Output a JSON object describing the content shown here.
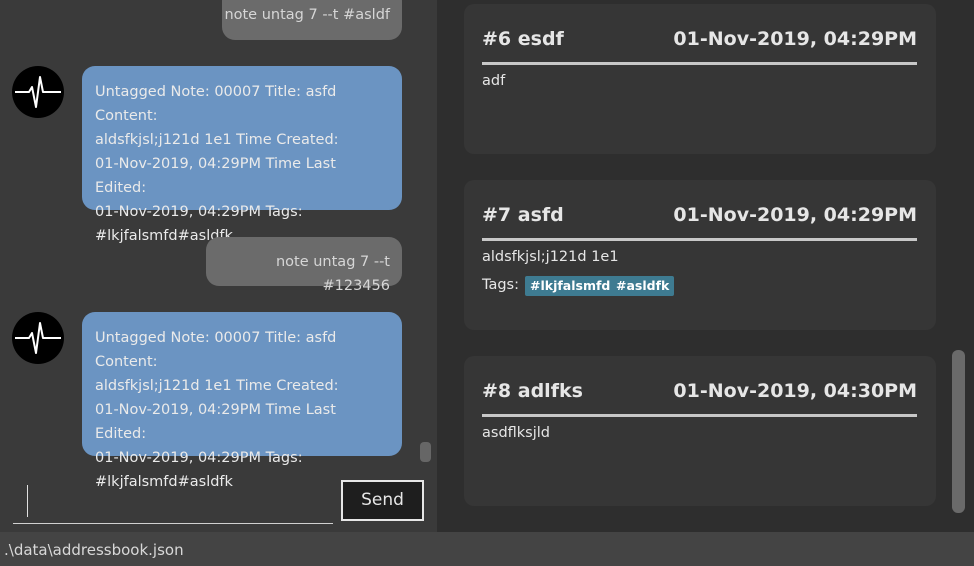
{
  "chat": {
    "messages": [
      {
        "role": "user",
        "text": "note untag 7 --t #asldf"
      },
      {
        "role": "bot",
        "lines": [
          "Untagged Note: 00007 Title: asfd Content:",
          "aldsfkjsl;j121d 1e1 Time Created:",
          "01-Nov-2019, 04:29PM Time Last Edited:",
          "01-Nov-2019, 04:29PM Tags:",
          "#lkjfalsmfd#asldfk"
        ]
      },
      {
        "role": "user",
        "text": "note untag 7 --t #123456"
      },
      {
        "role": "bot",
        "lines": [
          "Untagged Note: 00007 Title: asfd Content:",
          "aldsfkjsl;j121d 1e1 Time Created:",
          "01-Nov-2019, 04:29PM Time Last Edited:",
          "01-Nov-2019, 04:29PM Tags:",
          "#lkjfalsmfd#asldfk"
        ]
      }
    ],
    "input_value": "",
    "send_label": "Send",
    "avatar_icon": "heartbeat-pulse-icon"
  },
  "notes": [
    {
      "title": "#6 esdf",
      "time": "01-Nov-2019, 04:29PM",
      "content": "adf",
      "tags_label": "",
      "tags": []
    },
    {
      "title": "#7 asfd",
      "time": "01-Nov-2019, 04:29PM",
      "content": "aldsfkjsl;j121d 1e1",
      "tags_label": "Tags:",
      "tags": [
        "#lkjfalsmfd",
        "#asldfk"
      ]
    },
    {
      "title": "#8 adlfks",
      "time": "01-Nov-2019, 04:30PM",
      "content": "asdflksjld",
      "tags_label": "",
      "tags": []
    }
  ],
  "status_bar": {
    "path": ".\\data\\addressbook.json"
  },
  "colors": {
    "user_bubble": "#6b6b6b",
    "bot_bubble": "#6b94c2",
    "tag": "#3e7b91",
    "notes_background": "#2e2e2e"
  }
}
